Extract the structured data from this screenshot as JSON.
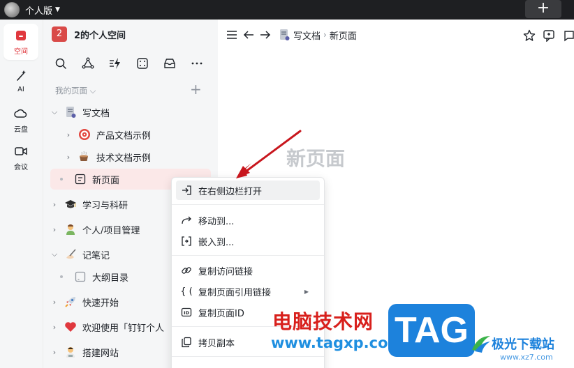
{
  "topbar": {
    "space_name": "个人版"
  },
  "rail": {
    "items": [
      {
        "label": "空间"
      },
      {
        "label": "AI"
      },
      {
        "label": "云盘"
      },
      {
        "label": "会议"
      }
    ]
  },
  "sidebar": {
    "space_badge": "2",
    "space_title": "2的个人空间",
    "section_label": "我的页面 ⌵",
    "tree": [
      {
        "label": "写文档"
      },
      {
        "label": "产品文档示例"
      },
      {
        "label": "技术文档示例"
      },
      {
        "label": "新页面"
      },
      {
        "label": "学习与科研"
      },
      {
        "label": "个人/项目管理"
      },
      {
        "label": "记笔记"
      },
      {
        "label": "大纲目录"
      },
      {
        "label": "快速开始"
      },
      {
        "label": "欢迎使用「钉钉个人"
      },
      {
        "label": "搭建网站"
      }
    ]
  },
  "main": {
    "breadcrumb": {
      "parent": "写文档",
      "sep": "›",
      "current": "新页面"
    },
    "page_title": "新页面"
  },
  "menu": {
    "items": [
      {
        "label": "在右侧边栏打开"
      },
      {
        "label": "移动到..."
      },
      {
        "label": "嵌入到..."
      },
      {
        "label": "复制访问链接"
      },
      {
        "label": "复制页面引用链接"
      },
      {
        "label": "复制页面ID"
      },
      {
        "label": "拷贝副本"
      }
    ]
  },
  "watermark": {
    "text": "电脑技术网",
    "url": "www.tagxp.com",
    "tag": "TAG",
    "site": "极光下载站",
    "site_url": "www.xz7.com"
  },
  "colors": {
    "accent": "#e0383e",
    "selected_bg": "#fbe8e8",
    "arrow": "#c8161d"
  }
}
